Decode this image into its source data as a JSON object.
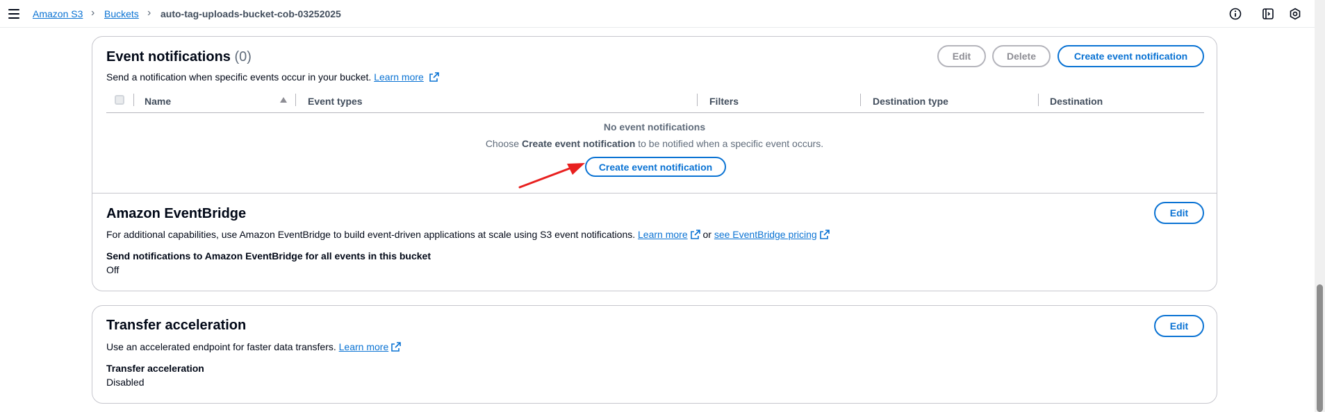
{
  "breadcrumbs": {
    "s3": "Amazon S3",
    "buckets": "Buckets",
    "bucket_name": "auto-tag-uploads-bucket-cob-03252025"
  },
  "topbar_icons": [
    "info-icon",
    "notes-icon",
    "settings-hex-icon"
  ],
  "event_notifications": {
    "title": "Event notifications",
    "count": "(0)",
    "description": "Send a notification when specific events occur in your bucket.",
    "learn_more": "Learn more",
    "edit_label": "Edit",
    "delete_label": "Delete",
    "create_label": "Create event notification",
    "columns": [
      "Name",
      "Event types",
      "Filters",
      "Destination type",
      "Destination"
    ],
    "empty_title": "No event notifications",
    "empty_prefix": "Choose ",
    "empty_bold": "Create event notification",
    "empty_suffix": " to be notified when a specific event occurs.",
    "empty_create_label": "Create event notification"
  },
  "eventbridge": {
    "title": "Amazon EventBridge",
    "edit_label": "Edit",
    "description": "For additional capabilities, use Amazon EventBridge to build event-driven applications at scale using S3 event notifications.",
    "learn_more": "Learn more",
    "or_text": "or",
    "pricing_link": "see EventBridge pricing",
    "setting_label": "Send notifications to Amazon EventBridge for all events in this bucket",
    "setting_value": "Off"
  },
  "transfer_acceleration": {
    "title": "Transfer acceleration",
    "edit_label": "Edit",
    "description": "Use an accelerated endpoint for faster data transfers.",
    "learn_more": "Learn more",
    "setting_label": "Transfer acceleration",
    "setting_value": "Disabled"
  },
  "colors": {
    "accent": "#0972d3",
    "annotation_arrow": "#e8201f"
  }
}
